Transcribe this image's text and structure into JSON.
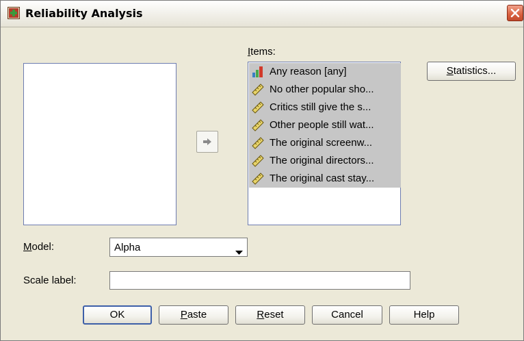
{
  "window": {
    "title": "Reliability Analysis",
    "icons": {
      "app": "reliability-app-icon",
      "close": "close-icon"
    }
  },
  "source_list": {
    "items": []
  },
  "items_panel": {
    "label": "Items:",
    "label_mnemonic": "I",
    "label_rest": "tems:",
    "items": [
      {
        "icon": "nominal-bar-icon",
        "label": "Any reason [any]"
      },
      {
        "icon": "scale-ruler-icon",
        "label": "No other popular sho..."
      },
      {
        "icon": "scale-ruler-icon",
        "label": "Critics still give the s..."
      },
      {
        "icon": "scale-ruler-icon",
        "label": "Other people still wat..."
      },
      {
        "icon": "scale-ruler-icon",
        "label": "The original screenw..."
      },
      {
        "icon": "scale-ruler-icon",
        "label": "The original directors..."
      },
      {
        "icon": "scale-ruler-icon",
        "label": "The original cast stay..."
      }
    ]
  },
  "buttons": {
    "statistics": {
      "label": "Statistics...",
      "mnemonic": "S",
      "rest": "tatistics..."
    },
    "move_arrow": {
      "icon": "arrow-right-icon"
    },
    "ok": "OK",
    "paste": {
      "label": "Paste",
      "mnemonic": "P",
      "rest": "aste"
    },
    "reset": {
      "label": "Reset",
      "mnemonic": "R",
      "rest": "eset"
    },
    "cancel": "Cancel",
    "help": "Help"
  },
  "model": {
    "label": "Model:",
    "mnemonic": "M",
    "rest": "odel:",
    "selected": "Alpha",
    "caret_icon": "dropdown-caret-icon"
  },
  "scale_label": {
    "label": "Scale label:",
    "value": ""
  },
  "colors": {
    "dialog_bg": "#ece9d8",
    "selection_bg": "#c6c6c6",
    "list_border": "#6d7cb0",
    "default_button_border": "#3d5fa8",
    "close_red": "#d9603e"
  }
}
